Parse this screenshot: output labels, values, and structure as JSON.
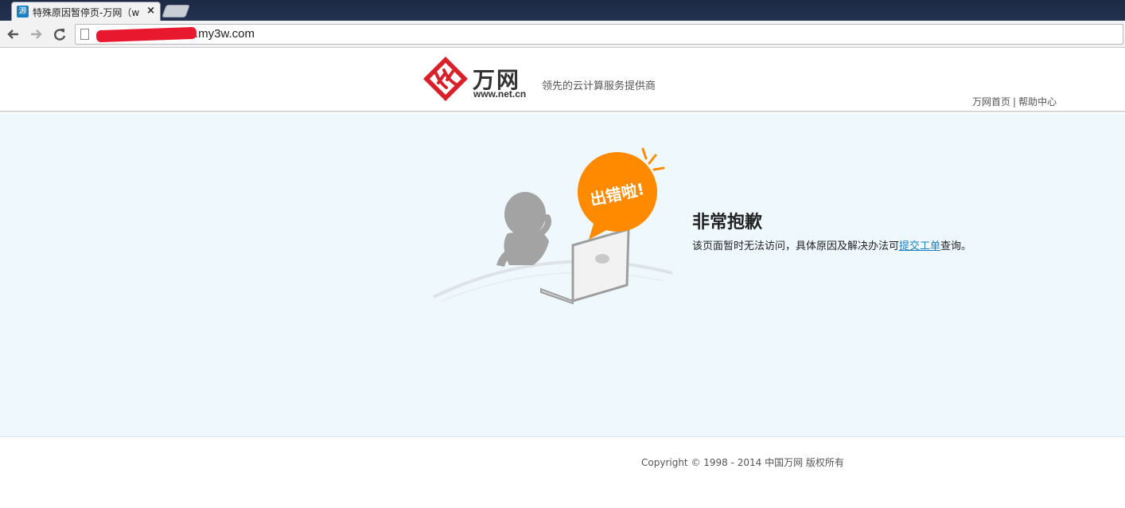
{
  "browser": {
    "tab_title": "特殊原因暂停页-万网（w",
    "tab_favicon": "源",
    "tab_close": "×",
    "url": ".my3w.com",
    "back_icon": "arrow-left",
    "forward_icon": "arrow-right",
    "reload_icon": "reload"
  },
  "header": {
    "logo_name": "万网",
    "logo_url": "www.net.cn",
    "tagline": "领先的云计算服务提供商",
    "links": [
      {
        "label": "万网首页"
      },
      {
        "label": "帮助中心"
      }
    ],
    "separator": "|"
  },
  "main": {
    "bubble_text": "出错啦!",
    "title": "非常抱歉",
    "message_prefix": "该页面暂时无法访问，具体原因及解决办法可",
    "message_link": "提交工单",
    "message_suffix": "查询。"
  },
  "footer": {
    "copyright": "Copyright © 1998 - 2014 中国万网 版权所有"
  },
  "colors": {
    "brand_red": "#d7202a",
    "bubble_orange": "#ff8a00",
    "main_bg": "#eff9fd",
    "link_blue": "#1a7fc1"
  }
}
